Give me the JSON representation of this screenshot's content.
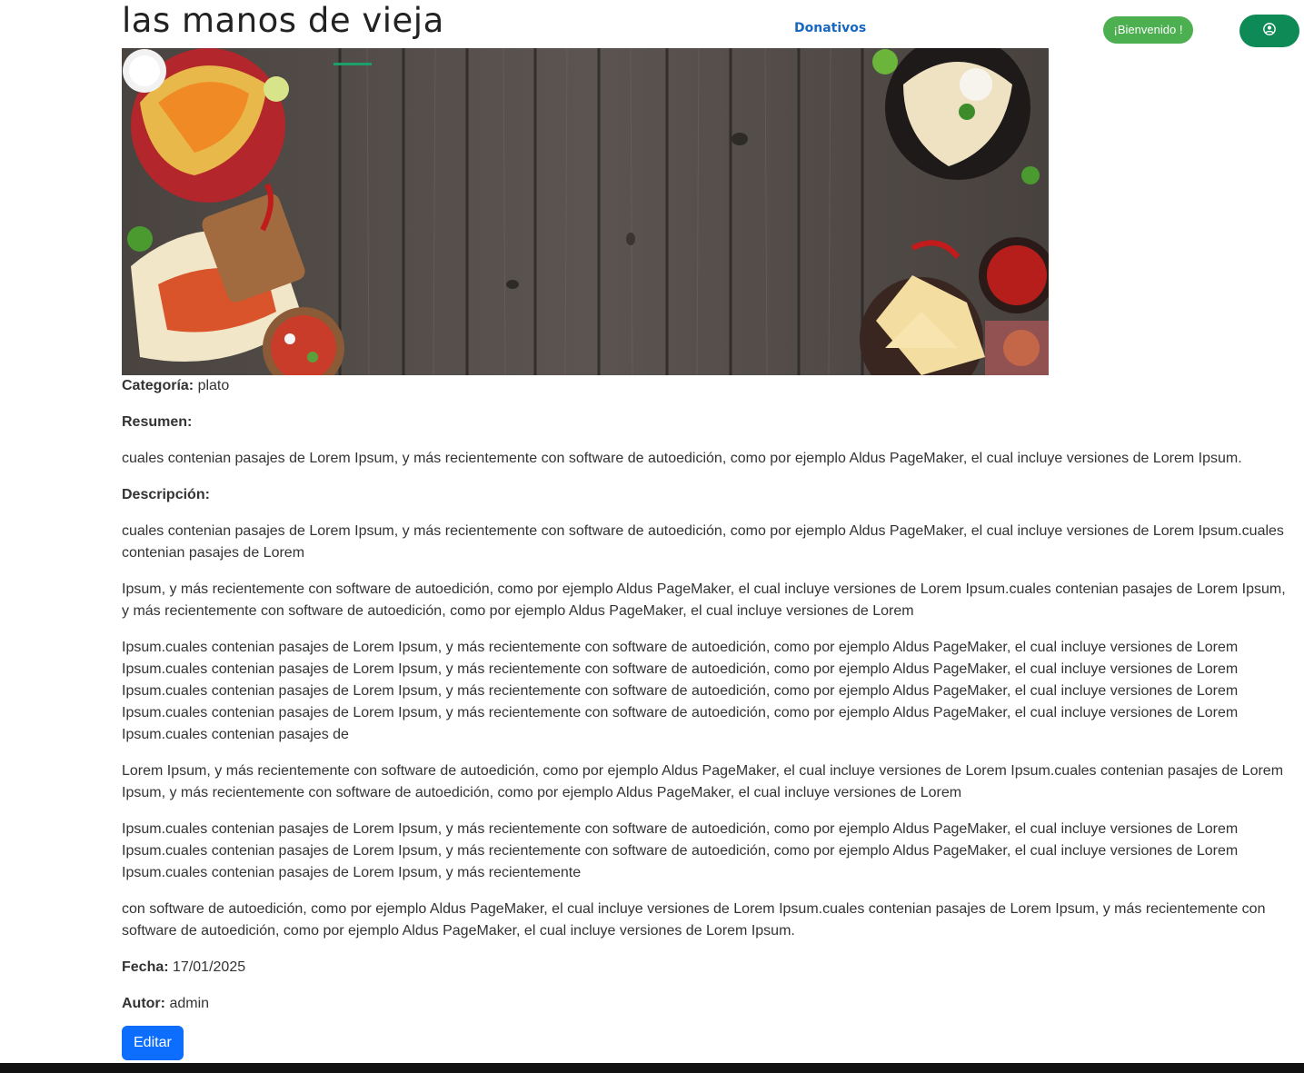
{
  "header": {
    "site_title": "las manos de vieja",
    "nav_donativos": "Donativos",
    "welcome_badge": "¡Bienvenido !"
  },
  "recipe": {
    "category_label": "Categoría:",
    "category_value": "plato",
    "summary_label": "Resumen:",
    "summary_text": "cuales contenian pasajes de Lorem Ipsum, y más recientemente con software de autoedición, como por ejemplo Aldus PageMaker, el cual incluye versiones de Lorem Ipsum.",
    "description_label": "Descripción:",
    "description_paragraphs": [
      "cuales contenian pasajes de Lorem Ipsum, y más recientemente con software de autoedición, como por ejemplo Aldus PageMaker, el cual incluye versiones de Lorem Ipsum.cuales contenian pasajes de Lorem",
      "Ipsum, y más recientemente con software de autoedición, como por ejemplo Aldus PageMaker, el cual incluye versiones de Lorem Ipsum.cuales contenian pasajes de Lorem Ipsum, y más recientemente con software de autoedición, como por ejemplo Aldus PageMaker, el cual incluye versiones de Lorem",
      "Ipsum.cuales contenian pasajes de Lorem Ipsum, y más recientemente con software de autoedición, como por ejemplo Aldus PageMaker, el cual incluye versiones de Lorem Ipsum.cuales contenian pasajes de Lorem Ipsum, y más recientemente con software de autoedición, como por ejemplo Aldus PageMaker, el cual incluye versiones de Lorem Ipsum.cuales contenian pasajes de Lorem Ipsum, y más recientemente con software de autoedición, como por ejemplo Aldus PageMaker, el cual incluye versiones de Lorem Ipsum.cuales contenian pasajes de Lorem Ipsum, y más recientemente con software de autoedición, como por ejemplo Aldus PageMaker, el cual incluye versiones de Lorem Ipsum.cuales contenian pasajes de",
      "Lorem Ipsum, y más recientemente con software de autoedición, como por ejemplo Aldus PageMaker, el cual incluye versiones de Lorem Ipsum.cuales contenian pasajes de Lorem Ipsum, y más recientemente con software de autoedición, como por ejemplo Aldus PageMaker, el cual incluye versiones de Lorem",
      "Ipsum.cuales contenian pasajes de Lorem Ipsum, y más recientemente con software de autoedición, como por ejemplo Aldus PageMaker, el cual incluye versiones de Lorem Ipsum.cuales contenian pasajes de Lorem Ipsum, y más recientemente con software de autoedición, como por ejemplo Aldus PageMaker, el cual incluye versiones de Lorem Ipsum.cuales contenian pasajes de Lorem Ipsum, y más recientemente",
      "con software de autoedición, como por ejemplo Aldus PageMaker, el cual incluye versiones de Lorem Ipsum.cuales contenian pasajes de Lorem Ipsum, y más recientemente con software de autoedición, como por ejemplo Aldus PageMaker, el cual incluye versiones de Lorem Ipsum."
    ],
    "date_label": "Fecha:",
    "date_value": "17/01/2025",
    "author_label": "Autor:",
    "author_value": "admin",
    "edit_label": "Editar"
  },
  "icons": {
    "user": "user-circle-icon"
  },
  "colors": {
    "nav_link": "#1867c0",
    "welcome_badge": "#4caf50",
    "user_button": "#0d8a55",
    "edit_button": "#0d6efd",
    "accent_underline": "#1aa068"
  }
}
